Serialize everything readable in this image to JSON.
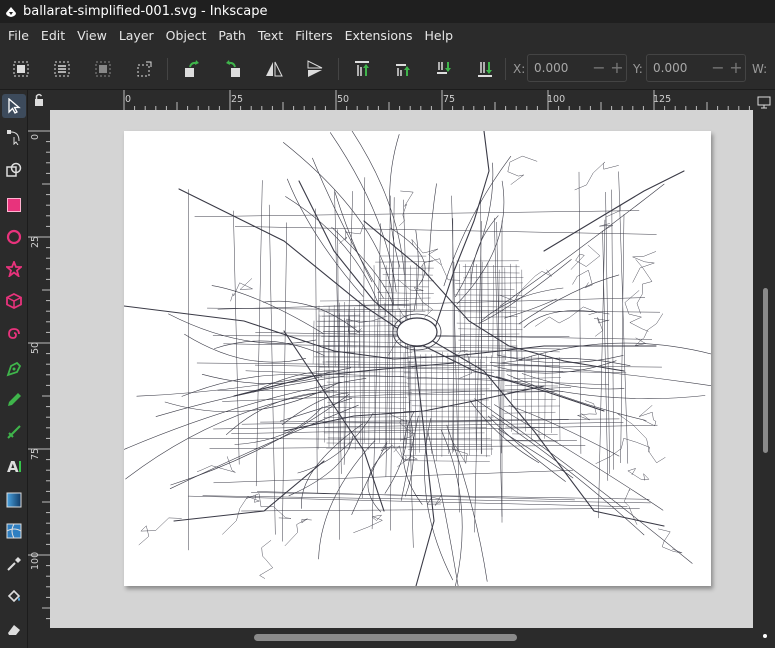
{
  "window": {
    "title": "ballarat-simplified-001.svg - Inkscape"
  },
  "menu": [
    "File",
    "Edit",
    "View",
    "Layer",
    "Object",
    "Path",
    "Text",
    "Filters",
    "Extensions",
    "Help"
  ],
  "commandbar": {
    "x_label": "X:",
    "x_value": "0.000",
    "y_label": "Y:",
    "y_value": "0.000",
    "w_label": "W:"
  },
  "ruler": {
    "horizontal": [
      "0",
      "25",
      "50",
      "75",
      "100",
      "125"
    ],
    "vertical": [
      "0",
      "25",
      "50",
      "75",
      "100"
    ]
  },
  "colors": {
    "accent_rect": "#e8337c",
    "accent_tool": "#3fb54b",
    "text_tool": "#35c44a",
    "active_tool_bg": "#3d4b5c"
  }
}
